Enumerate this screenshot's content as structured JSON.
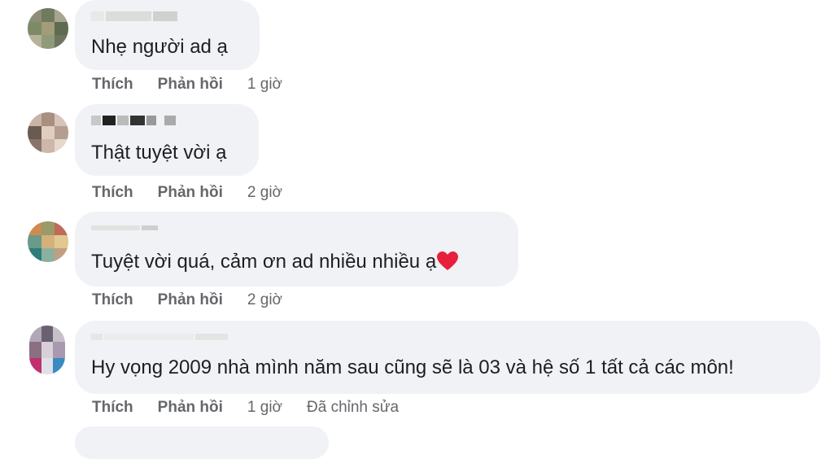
{
  "comments": [
    {
      "text": "Nhẹ người ad ạ",
      "actions": {
        "like": "Thích",
        "reply": "Phản hồi",
        "time": "1 giờ"
      }
    },
    {
      "text": "Thật tuyệt vời ạ",
      "actions": {
        "like": "Thích",
        "reply": "Phản hồi",
        "time": "2 giờ"
      }
    },
    {
      "text": "Tuyệt vời quá, cảm ơn ad nhiều nhiều ạ",
      "emoji": "heart",
      "actions": {
        "like": "Thích",
        "reply": "Phản hồi",
        "time": "2 giờ"
      }
    },
    {
      "text": "Hy vọng 2009 nhà mình năm sau cũng sẽ là 03 và hệ số 1 tất cả các môn!",
      "actions": {
        "like": "Thích",
        "reply": "Phản hồi",
        "time": "1 giờ",
        "edited": "Đã chỉnh sửa"
      }
    }
  ],
  "colors": {
    "bubble": "#f0f2f5",
    "action_text": "#65676b",
    "heart": "#e8203b"
  }
}
